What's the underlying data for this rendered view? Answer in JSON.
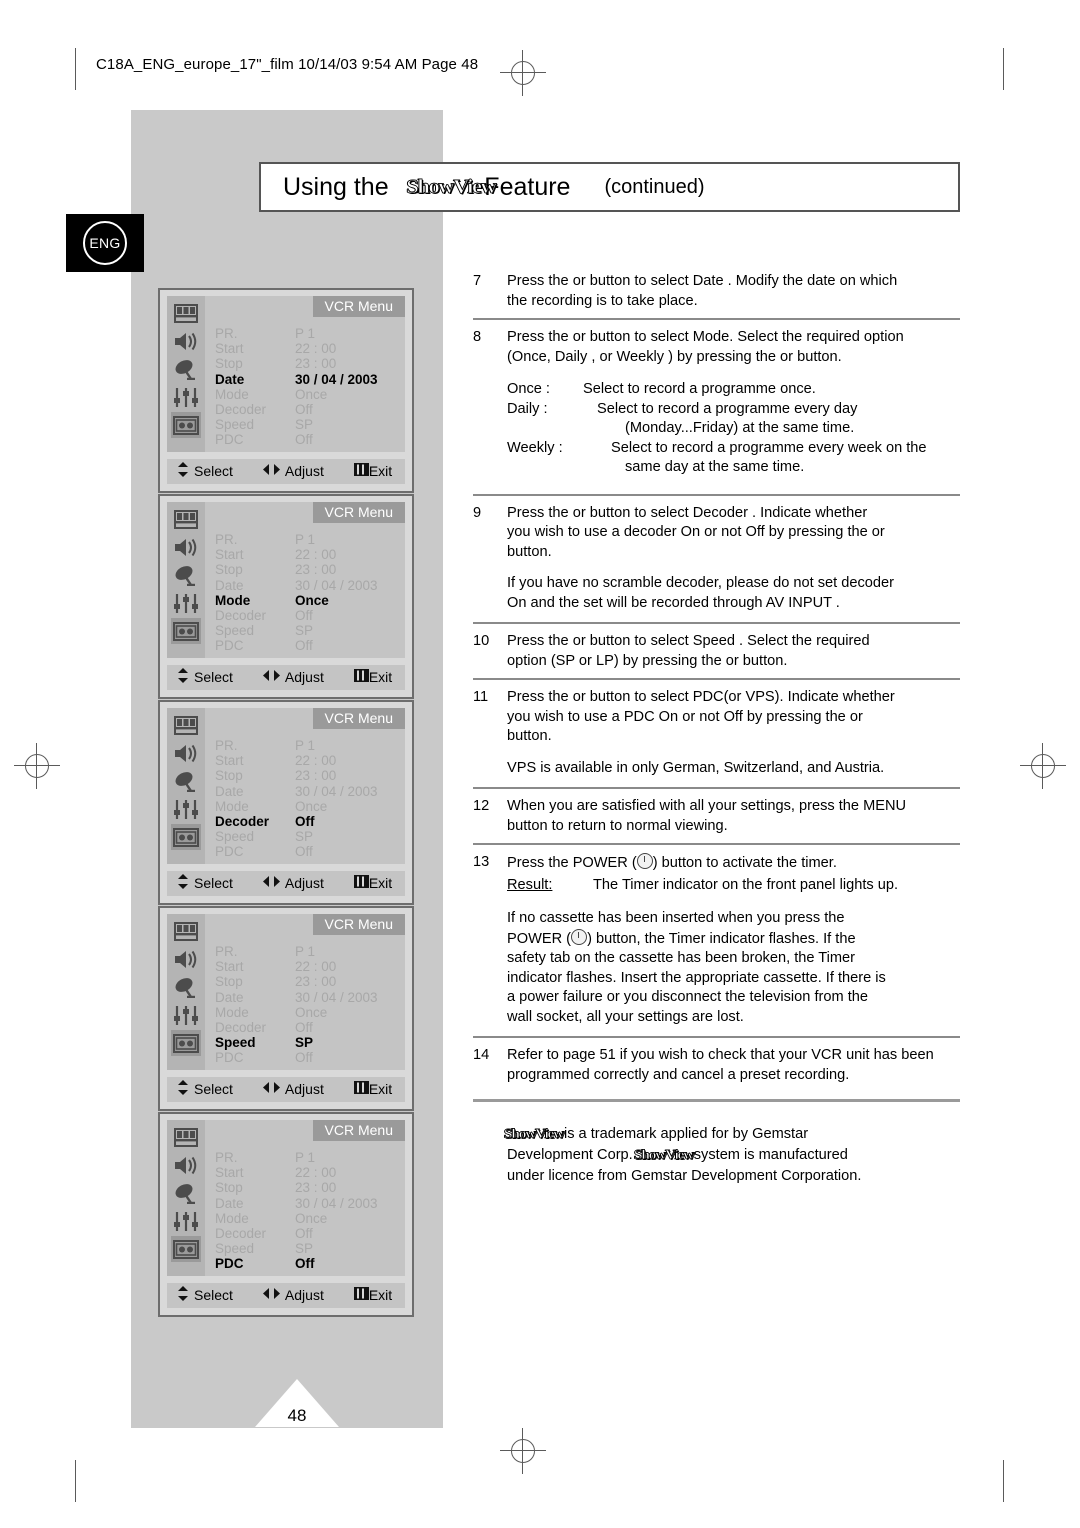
{
  "print_header": "C18A_ENG_europe_17\"_film  10/14/03  9:54 AM  Page 48",
  "lang_badge": "ENG",
  "title": {
    "prefix": "Using the",
    "logo": "ShowView",
    "suffix": "Feature",
    "continued": "(continued)"
  },
  "page_number": "48",
  "menu_common": {
    "title": "VCR Menu",
    "nav": {
      "select": "Select",
      "adjust": "Adjust",
      "exit": "Exit"
    },
    "icons": [
      "picture-icon",
      "sound-icon",
      "channel-icon",
      "feature-icon",
      "vcr-icon"
    ],
    "rows": [
      {
        "label": "PR.",
        "value": "P  1"
      },
      {
        "label": "Start",
        "value": "22 : 00"
      },
      {
        "label": "Stop",
        "value": "23 : 00"
      },
      {
        "label": "Date",
        "value": "30 / 04 / 2003"
      },
      {
        "label": "Mode",
        "value": "Once"
      },
      {
        "label": "Decoder",
        "value": "Off"
      },
      {
        "label": "Speed",
        "value": "SP"
      },
      {
        "label": "PDC",
        "value": "Off"
      }
    ]
  },
  "menus": [
    {
      "highlight": "Date"
    },
    {
      "highlight": "Mode"
    },
    {
      "highlight": "Decoder"
    },
    {
      "highlight": "Speed"
    },
    {
      "highlight": "PDC"
    }
  ],
  "steps": {
    "s7": {
      "num": "7",
      "line1": "Press the      or      button to select Date . Modify the date on which",
      "line2": "the recording is to take place."
    },
    "s8": {
      "num": "8",
      "line1": "Press the      or      button to select Mode. Select the required option",
      "line2": "(Once, Daily  , or Weekly ) by pressing the      or      button.",
      "modes": [
        {
          "key": "Once :",
          "line1": "Select to record a programme once.",
          "line2": ""
        },
        {
          "key": "Daily :",
          "line1": "Select to record a programme every day",
          "line2": "(Monday...Friday) at the same time."
        },
        {
          "key": "Weekly :",
          "line1": "Select to record a programme every week on the",
          "line2": "same day at the same time."
        }
      ]
    },
    "s9": {
      "num": "9",
      "line1": "Press the      or     button to select Decoder . Indicate whether",
      "line2": "you  wish to use a decoder On or not Off  by pressing the     or",
      "line3": "button.",
      "note1": "If you have no scramble decoder, please do not set decoder",
      "note2": "On and the set will be recorded through  AV INPUT ."
    },
    "s10": {
      "num": "10",
      "line1": "Press the     or      button to select Speed . Select the required",
      "line2": "option (SP or LP) by pressing the     or     button."
    },
    "s11": {
      "num": "11",
      "line1": "Press the     or     button to select PDC(or VPS). Indicate whether",
      "line2": "you wish to use a PDC On or not Off  by pressing the     or",
      "line3": "button.",
      "note1": "VPS is available in only German, Switzerland, and Austria."
    },
    "s12": {
      "num": "12",
      "line1": "When you are satisfied with all your settings, press the MENU",
      "line2": "button to return to normal viewing."
    },
    "s13": {
      "num": "13",
      "line1_a": "Press the POWER (",
      "line1_b": ") button to activate the timer.",
      "result_key": "Result:",
      "result_val": "The Timer indicator on the front panel lights up.",
      "note_a": "If no cassette has been inserted when you press the",
      "note_b": "POWER (",
      "note_c": ") button, the Timer indicator flashes. If the",
      "note_d": "safety tab on the cassette has been broken, the Timer",
      "note_e": "indicator flashes. Insert the appropriate cassette. If there is",
      "note_f": "a power failure or you disconnect the television from the",
      "note_g": "wall socket, all your settings are lost."
    },
    "s14": {
      "num": "14",
      "line1": "Refer to page 51 if you wish to check that your VCR unit has been",
      "line2": "programmed correctly and cancel a preset recording."
    }
  },
  "trademark": {
    "l1_logo": "ShowView",
    "l1_rest": "is a trademark applied for by Gemstar",
    "l2_a": "Development Corp.",
    "l2_logo": "ShowView",
    "l2_b": "system is manufactured",
    "l3": "under licence from Gemstar Development Corporation."
  }
}
